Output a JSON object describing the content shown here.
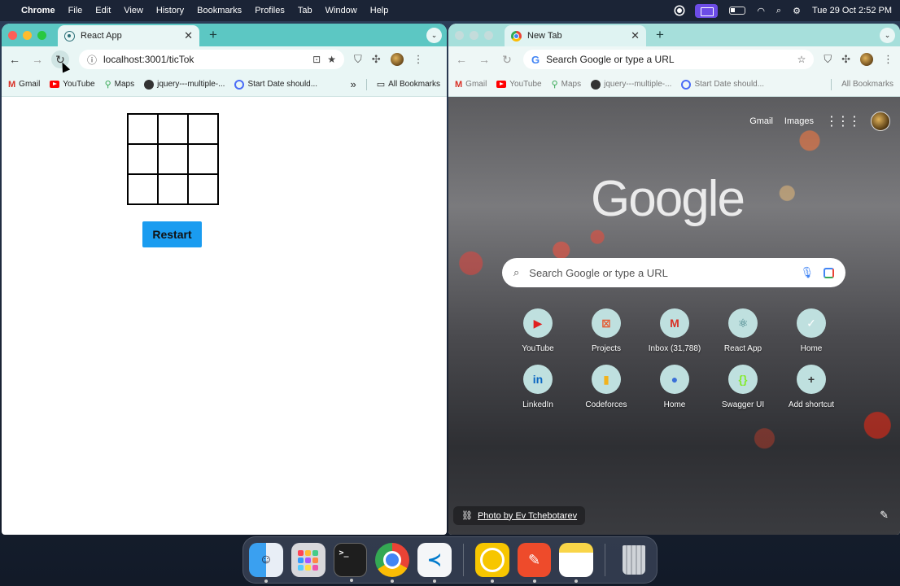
{
  "menubar": {
    "app": "Chrome",
    "menus": [
      "File",
      "Edit",
      "View",
      "History",
      "Bookmarks",
      "Profiles",
      "Tab",
      "Window",
      "Help"
    ],
    "clock": "Tue 29 Oct  2:52 PM"
  },
  "left_window": {
    "tab_title": "React App",
    "url": "localhost:3001/ticTok",
    "bookmarks": [
      "Gmail",
      "YouTube",
      "Maps",
      "jquery---multiple-...",
      "Start Date should..."
    ],
    "more": "»",
    "all_bookmarks": "All Bookmarks",
    "board": [
      "",
      "",
      "",
      "",
      "",
      "",
      "",
      "",
      ""
    ],
    "restart_label": "Restart"
  },
  "right_window": {
    "tab_title": "New Tab",
    "omnibox_placeholder": "Search Google or type a URL",
    "bookmarks": [
      "Gmail",
      "YouTube",
      "Maps",
      "jquery---multiple-...",
      "Start Date should..."
    ],
    "all_bookmarks": "All Bookmarks",
    "top_links": [
      "Gmail",
      "Images"
    ],
    "logo": "Google",
    "search_placeholder": "Search Google or type a URL",
    "shortcuts": [
      {
        "label": "YouTube",
        "glyph": "▶",
        "color": "#e02020"
      },
      {
        "label": "Projects",
        "glyph": "⊠",
        "color": "#e8552a"
      },
      {
        "label": "Inbox (31,788)",
        "glyph": "M",
        "color": "#d93025"
      },
      {
        "label": "React App",
        "glyph": "⚛",
        "color": "#2b6f78"
      },
      {
        "label": "Home",
        "glyph": "✓",
        "color": "#ffffff"
      },
      {
        "label": "LinkedIn",
        "glyph": "in",
        "color": "#0a66c2"
      },
      {
        "label": "Codeforces",
        "glyph": "▮",
        "color": "#f2b21b"
      },
      {
        "label": "Home",
        "glyph": "●",
        "color": "#3a6fd8"
      },
      {
        "label": "Swagger UI",
        "glyph": "{}",
        "color": "#85ea2d"
      },
      {
        "label": "Add shortcut",
        "glyph": "+",
        "color": "#333333"
      }
    ],
    "photo_credit": "Photo by Ev Tchebotarev"
  },
  "dock": {
    "apps": [
      "Finder",
      "Launchpad",
      "Terminal",
      "Google Chrome",
      "Visual Studio Code",
      "WhatsApp",
      "Pen",
      "Notes",
      "Trash"
    ],
    "terminal_prompt": ">_",
    "vscode_glyph": "≺"
  }
}
